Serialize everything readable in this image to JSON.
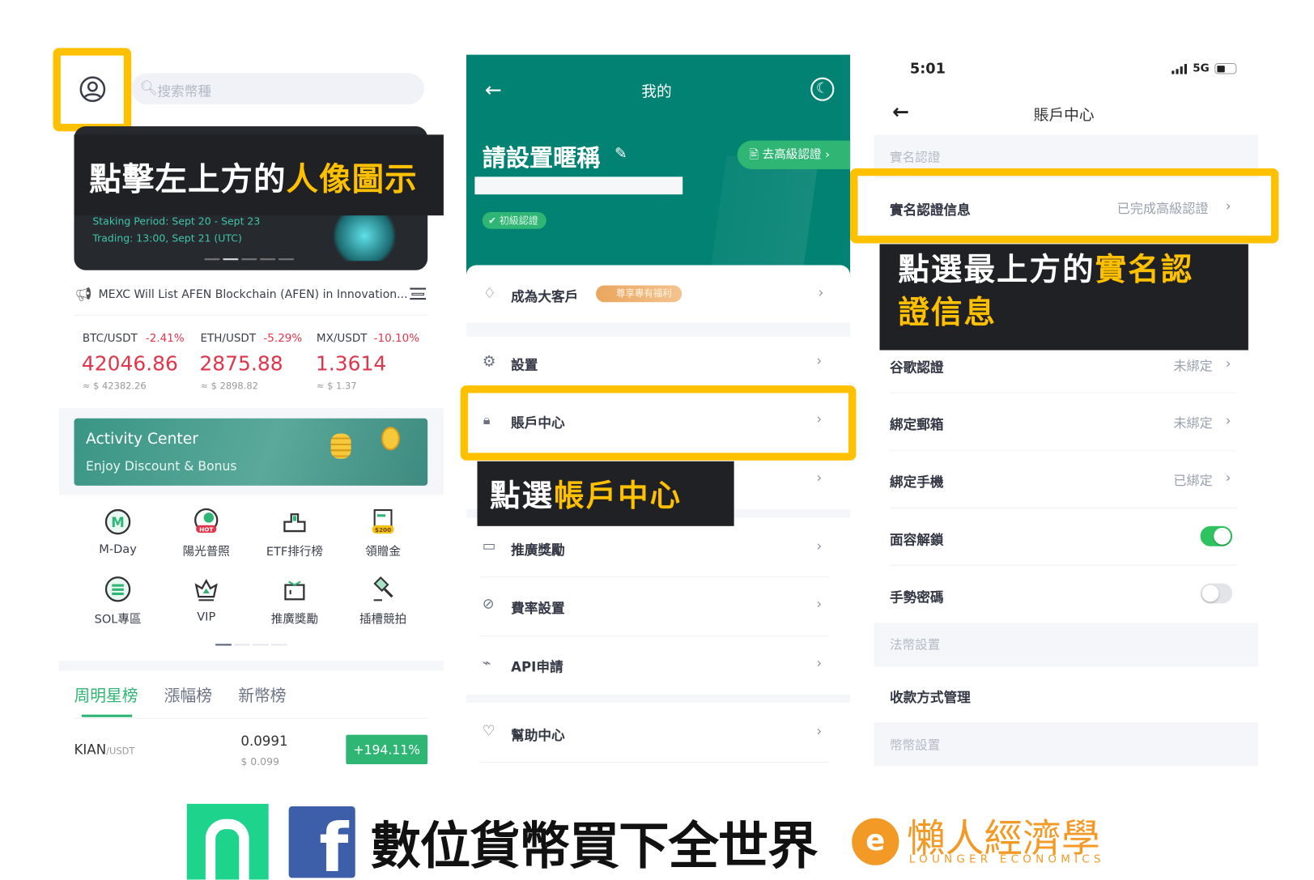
{
  "left": {
    "search_placeholder": "搜索幣種",
    "caption_white": "點擊左上方的",
    "caption_yellow": "人像圖示",
    "banner_line1": "Staking Period: Sept 20 - Sept 23",
    "banner_line2": "Trading: 13:00, Sept 21 (UTC)",
    "announcement": "MEXC Will List AFEN Blockchain (AFEN) in Innovation...",
    "tickers": [
      {
        "pair": "BTC/USDT",
        "change": "-2.41%",
        "price": "42046.86",
        "approx": "≈ $ 42382.26"
      },
      {
        "pair": "ETH/USDT",
        "change": "-5.29%",
        "price": "2875.88",
        "approx": "≈ $ 2898.82"
      },
      {
        "pair": "MX/USDT",
        "change": "-10.10%",
        "price": "1.3614",
        "approx": "≈ $ 1.37"
      }
    ],
    "activity_title": "Activity Center",
    "activity_sub": "Enjoy Discount & Bonus",
    "grid": [
      {
        "label": "M-Day",
        "icon": "m-day-icon"
      },
      {
        "label": "陽光普照",
        "icon": "hot-icon",
        "badge": "HOT"
      },
      {
        "label": "ETF排行榜",
        "icon": "etf-rank-icon"
      },
      {
        "label": "領贈金",
        "icon": "bonus-icon",
        "badge": "$200"
      },
      {
        "label": "SOL專區",
        "icon": "sol-icon"
      },
      {
        "label": "VIP",
        "icon": "crown-icon"
      },
      {
        "label": "推廣獎勵",
        "icon": "gift-icon"
      },
      {
        "label": "插槽競拍",
        "icon": "auction-hammer-icon"
      }
    ],
    "tabs": [
      "周明星榜",
      "漲幅榜",
      "新幣榜"
    ],
    "market_row": {
      "base": "KIAN",
      "quote": "/USDT",
      "price": "0.0991",
      "usd": "$ 0.099",
      "change": "+194.11%"
    }
  },
  "middle": {
    "title": "我的",
    "nickname": "請設置暱稱",
    "advanced_verify": "去高級認證",
    "basic_badge": "初級認證",
    "vip_row": {
      "label": "成為大客戶",
      "badge": "尊享專有福利"
    },
    "items": [
      {
        "label": "設置",
        "icon": "gear-icon"
      },
      {
        "label": "賬戶中心",
        "icon": "lock-icon"
      },
      {
        "label": "推廣獎勵",
        "icon": "wallet-icon"
      },
      {
        "label": "費率設置",
        "icon": "fee-icon"
      },
      {
        "label": "API申請",
        "icon": "api-icon"
      },
      {
        "label": "幫助中心",
        "icon": "heart-icon"
      }
    ],
    "caption_white": "點選",
    "caption_yellow": "帳戶中心"
  },
  "right": {
    "time": "5:01",
    "network": "5G",
    "title": "賬戶中心",
    "section1": "實名認證",
    "kyc_row": {
      "label": "實名認證信息",
      "value": "已完成高級認證"
    },
    "caption_white": "點選最上方的",
    "caption_yellow1": "實名認",
    "caption_yellow2": "證信息",
    "rows": [
      {
        "label": "谷歌認證",
        "value": "未綁定"
      },
      {
        "label": "綁定郵箱",
        "value": "未綁定"
      },
      {
        "label": "綁定手機",
        "value": "已綁定"
      }
    ],
    "face_unlock": {
      "label": "面容解鎖",
      "on": true
    },
    "gesture": {
      "label": "手勢密碼",
      "on": false
    },
    "section2": "法幣設置",
    "payment": "收款方式管理",
    "section3": "幣幣設置"
  },
  "footer": {
    "slogan": "數位貨幣買下全世界",
    "brand": "懶人經濟學",
    "brand_en": "LOUNGER ECONOMICS"
  },
  "colors": {
    "highlight": "#ffc000",
    "teal": "#028272",
    "green": "#2fb574",
    "red": "#e0364b"
  }
}
